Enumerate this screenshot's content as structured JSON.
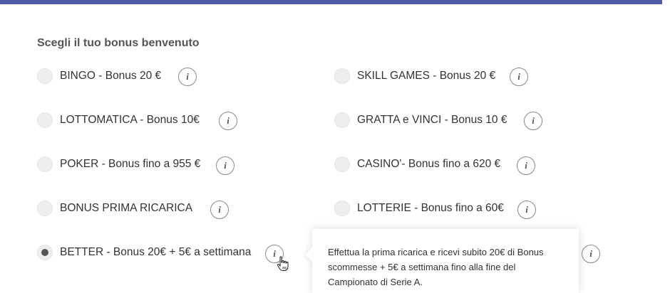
{
  "form": {
    "heading": "Scegli il tuo bonus benvenuto",
    "info_glyph": "i",
    "options_left": [
      {
        "label": "BINGO - Bonus 20 €",
        "checked": false
      },
      {
        "label": "LOTTOMATICA - Bonus 10€",
        "checked": false
      },
      {
        "label": "POKER - Bonus fino a 955 €",
        "checked": false
      },
      {
        "label": "BONUS PRIMA RICARICA",
        "checked": false
      },
      {
        "label": "BETTER - Bonus 20€ + 5€ a settimana",
        "checked": true
      }
    ],
    "options_right": [
      {
        "label": "SKILL GAMES - Bonus 20 €",
        "checked": false
      },
      {
        "label": "GRATTA e VINCI - Bonus 10 €",
        "checked": false
      },
      {
        "label": "CASINO'- Bonus fino a 620 €",
        "checked": false
      },
      {
        "label": "LOTTERIE - Bonus fino a 60€",
        "checked": false
      }
    ]
  },
  "tooltip": {
    "text": "Effettua la prima ricarica e ricevi subito 20€ di Bonus scommesse + 5€ a settimana fino alla fine del Campionato di Serie A."
  },
  "colors": {
    "topbar": "#4f5aa8"
  }
}
